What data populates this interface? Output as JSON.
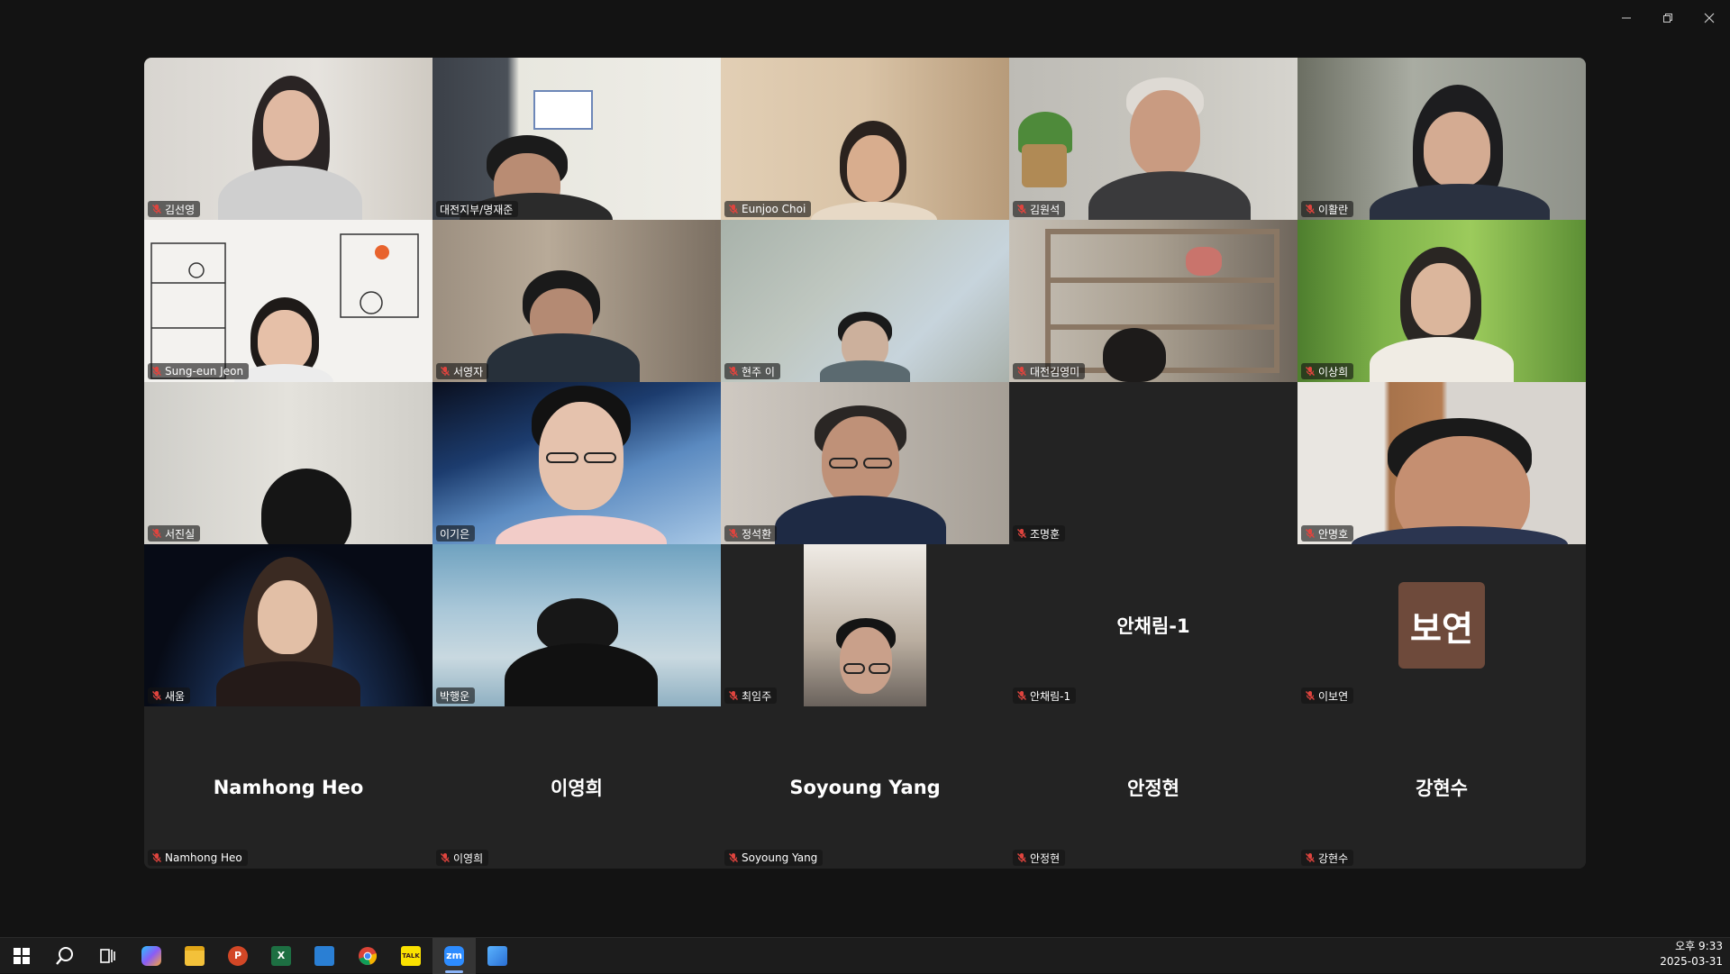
{
  "window": {
    "controls": [
      "minimize",
      "restore",
      "close"
    ]
  },
  "participants": [
    {
      "name": "김선영",
      "muted": true
    },
    {
      "name": "대전지부/명재준",
      "muted": false
    },
    {
      "name": "Eunjoo Choi",
      "muted": true
    },
    {
      "name": "김원석",
      "muted": true
    },
    {
      "name": "이활란",
      "muted": true
    },
    {
      "name": "Sung-eun Jeon",
      "muted": true
    },
    {
      "name": "서영자",
      "muted": true
    },
    {
      "name": "현주 이",
      "muted": true
    },
    {
      "name": "대전김영미",
      "muted": true
    },
    {
      "name": "이상희",
      "muted": true
    },
    {
      "name": "서진실",
      "muted": true
    },
    {
      "name": "이기은",
      "muted": false,
      "active_speaker": true
    },
    {
      "name": "정석환",
      "muted": true
    },
    {
      "name": "조명훈",
      "muted": true
    },
    {
      "name": "안명호",
      "muted": true
    },
    {
      "name": "새움",
      "muted": true
    },
    {
      "name": "박행운",
      "muted": false
    },
    {
      "name": "최임주",
      "muted": true
    },
    {
      "name": "안채림-1",
      "muted": true,
      "display_name": "안채림-1"
    },
    {
      "name": "이보연",
      "muted": true,
      "avatar_text": "보연",
      "avatar_color": "#6e4a3b"
    },
    {
      "name": "Namhong Heo",
      "muted": true,
      "display_name": "Namhong Heo"
    },
    {
      "name": "이영희",
      "muted": true,
      "display_name": "이영희"
    },
    {
      "name": "Soyoung Yang",
      "muted": true,
      "display_name": "Soyoung Yang"
    },
    {
      "name": "안정현",
      "muted": true,
      "display_name": "안정현"
    },
    {
      "name": "강현수",
      "muted": true,
      "display_name": "강현수"
    }
  ],
  "colors": {
    "active_speaker_border": "#23d96b",
    "muted_mic": "#e0443e",
    "tile_bg": "#232323"
  },
  "taskbar": {
    "apps": [
      {
        "name": "start",
        "icon": "windows-icon"
      },
      {
        "name": "search",
        "icon": "search-icon"
      },
      {
        "name": "task-view",
        "icon": "task-view-icon"
      },
      {
        "name": "copilot",
        "icon": "copilot-icon"
      },
      {
        "name": "file-explorer",
        "icon": "folder-icon"
      },
      {
        "name": "powerpoint",
        "icon": "powerpoint-icon",
        "label": "P"
      },
      {
        "name": "excel",
        "icon": "excel-icon",
        "label": "X"
      },
      {
        "name": "app-blue",
        "icon": "blue-app-icon"
      },
      {
        "name": "chrome",
        "icon": "chrome-icon"
      },
      {
        "name": "kakaotalk",
        "icon": "kakaotalk-icon",
        "label": "TALK"
      },
      {
        "name": "zoom",
        "icon": "zoom-icon",
        "label": "zm",
        "active": true
      },
      {
        "name": "photos",
        "icon": "photos-icon"
      }
    ],
    "clock": {
      "time": "오후 9:33",
      "date": "2025-03-31"
    }
  }
}
